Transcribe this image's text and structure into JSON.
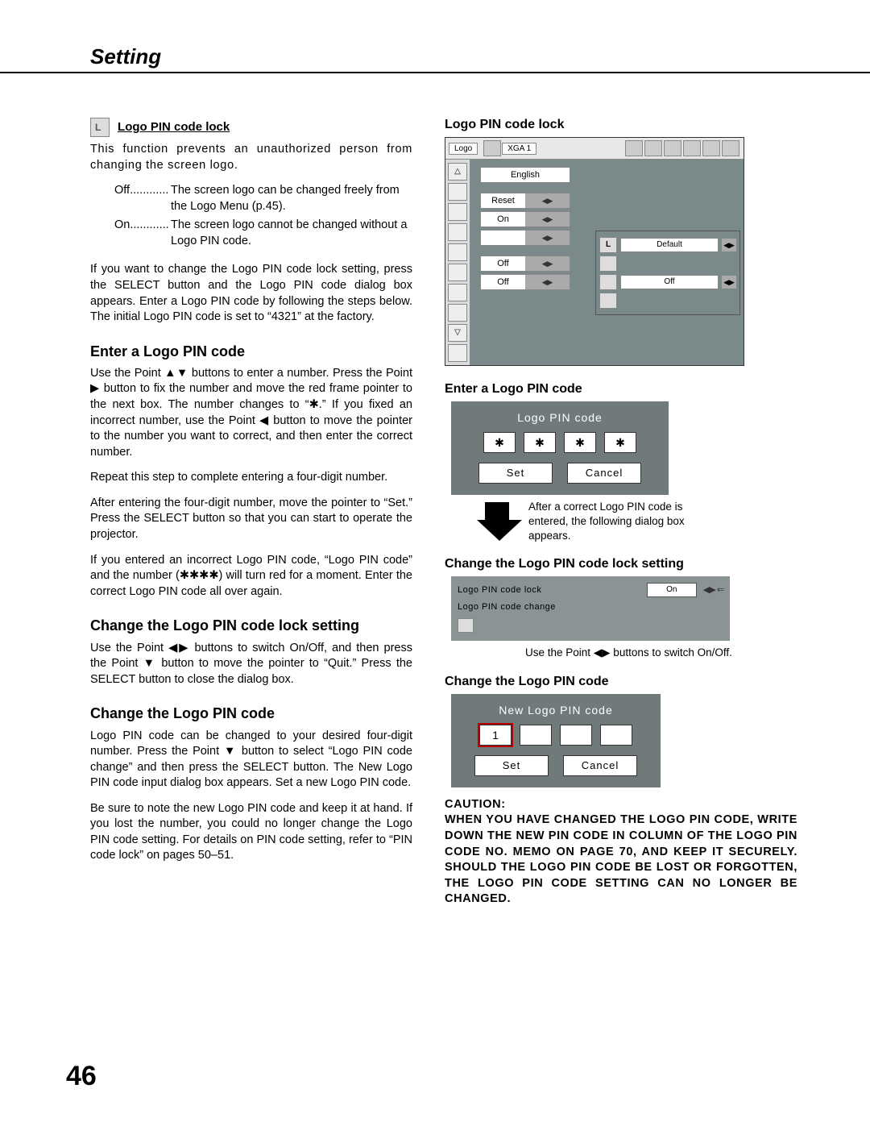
{
  "header": {
    "title": "Setting"
  },
  "left": {
    "sec1_title": "Logo PIN code lock",
    "sec1_intro": "This function prevents an unauthorized person from changing the screen logo.",
    "off_label": "Off............",
    "off_text": "The screen logo can be changed freely from the Logo Menu (p.45).",
    "on_label": "On............",
    "on_text": "The screen logo cannot be changed without a Logo PIN code.",
    "sec1_p2": "If you want to change the Logo PIN code lock setting, press the SELECT button and the Logo PIN code dialog box appears. Enter a Logo PIN code by following the steps below. The initial Logo PIN code is set to “4321” at the factory.",
    "sec2_title": "Enter a Logo PIN code",
    "sec2_p1": "Use the Point ▲▼ buttons to enter a number. Press the Point ▶ button to fix the number and move the red frame pointer to the next box. The number changes to “✱.” If you fixed an incorrect number, use the Point ◀ button to move the pointer to the number you want to correct, and then enter the correct number.",
    "sec2_p2": "Repeat this step to complete entering a four-digit number.",
    "sec2_p3": "After entering the four-digit number, move the pointer to “Set.” Press the SELECT button so that you can start to operate the projector.",
    "sec2_p4": "If you entered an incorrect Logo PIN code, “Logo PIN code” and the number (✱✱✱✱) will turn red for a moment. Enter the correct Logo PIN code all over again.",
    "sec3_title": "Change the Logo PIN code lock setting",
    "sec3_p1": "Use the Point ◀▶ buttons to switch On/Off, and then press the Point ▼ button to move the pointer to “Quit.” Press the SELECT button to close the dialog box.",
    "sec4_title": "Change the Logo PIN code",
    "sec4_p1": "Logo PIN code can be changed to your desired four-digit number. Press the Point ▼ button to select “Logo PIN code change” and then press the SELECT button. The New Logo PIN code input dialog box appears. Set a new Logo PIN code.",
    "sec4_p2": "Be sure to note the new Logo PIN code and keep it at hand. If you lost the number, you could no longer change the Logo PIN code setting. For details on PIN code setting, refer to “PIN code lock” on pages 50–51."
  },
  "right": {
    "fig1_title": "Logo PIN code lock",
    "menu_logo": "Logo",
    "menu_xga": "XGA 1",
    "menu_opts": [
      "English",
      "Reset",
      "On",
      "",
      "Off",
      "Off"
    ],
    "submenu_default": "Default",
    "submenu_off": "Off",
    "fig2_title": "Enter a Logo PIN code",
    "pin_dialog_title": "Logo PIN code",
    "pin_star": "✱",
    "pin_set": "Set",
    "pin_cancel": "Cancel",
    "arrow_note": "After a correct Logo PIN code is entered, the following dialog box appears.",
    "fig3_title": "Change the Logo PIN code lock setting",
    "lock_row1": "Logo PIN code lock",
    "lock_on": "On",
    "lock_row2": "Logo PIN code change",
    "after_lock_note": "Use the Point ◀▶ buttons to switch On/Off.",
    "fig4_title": "Change the Logo PIN code",
    "new_pin_title": "New Logo PIN code",
    "new_pin_first": "1",
    "caution_label": "CAUTION:",
    "caution_text": "WHEN YOU HAVE CHANGED THE LOGO PIN CODE, WRITE DOWN THE NEW PIN CODE IN COLUMN OF THE LOGO PIN CODE NO. MEMO ON PAGE 70, AND KEEP IT SECURELY. SHOULD THE LOGO PIN CODE BE LOST OR FORGOTTEN, THE LOGO PIN CODE SETTING CAN NO LONGER BE CHANGED."
  },
  "page_number": "46"
}
